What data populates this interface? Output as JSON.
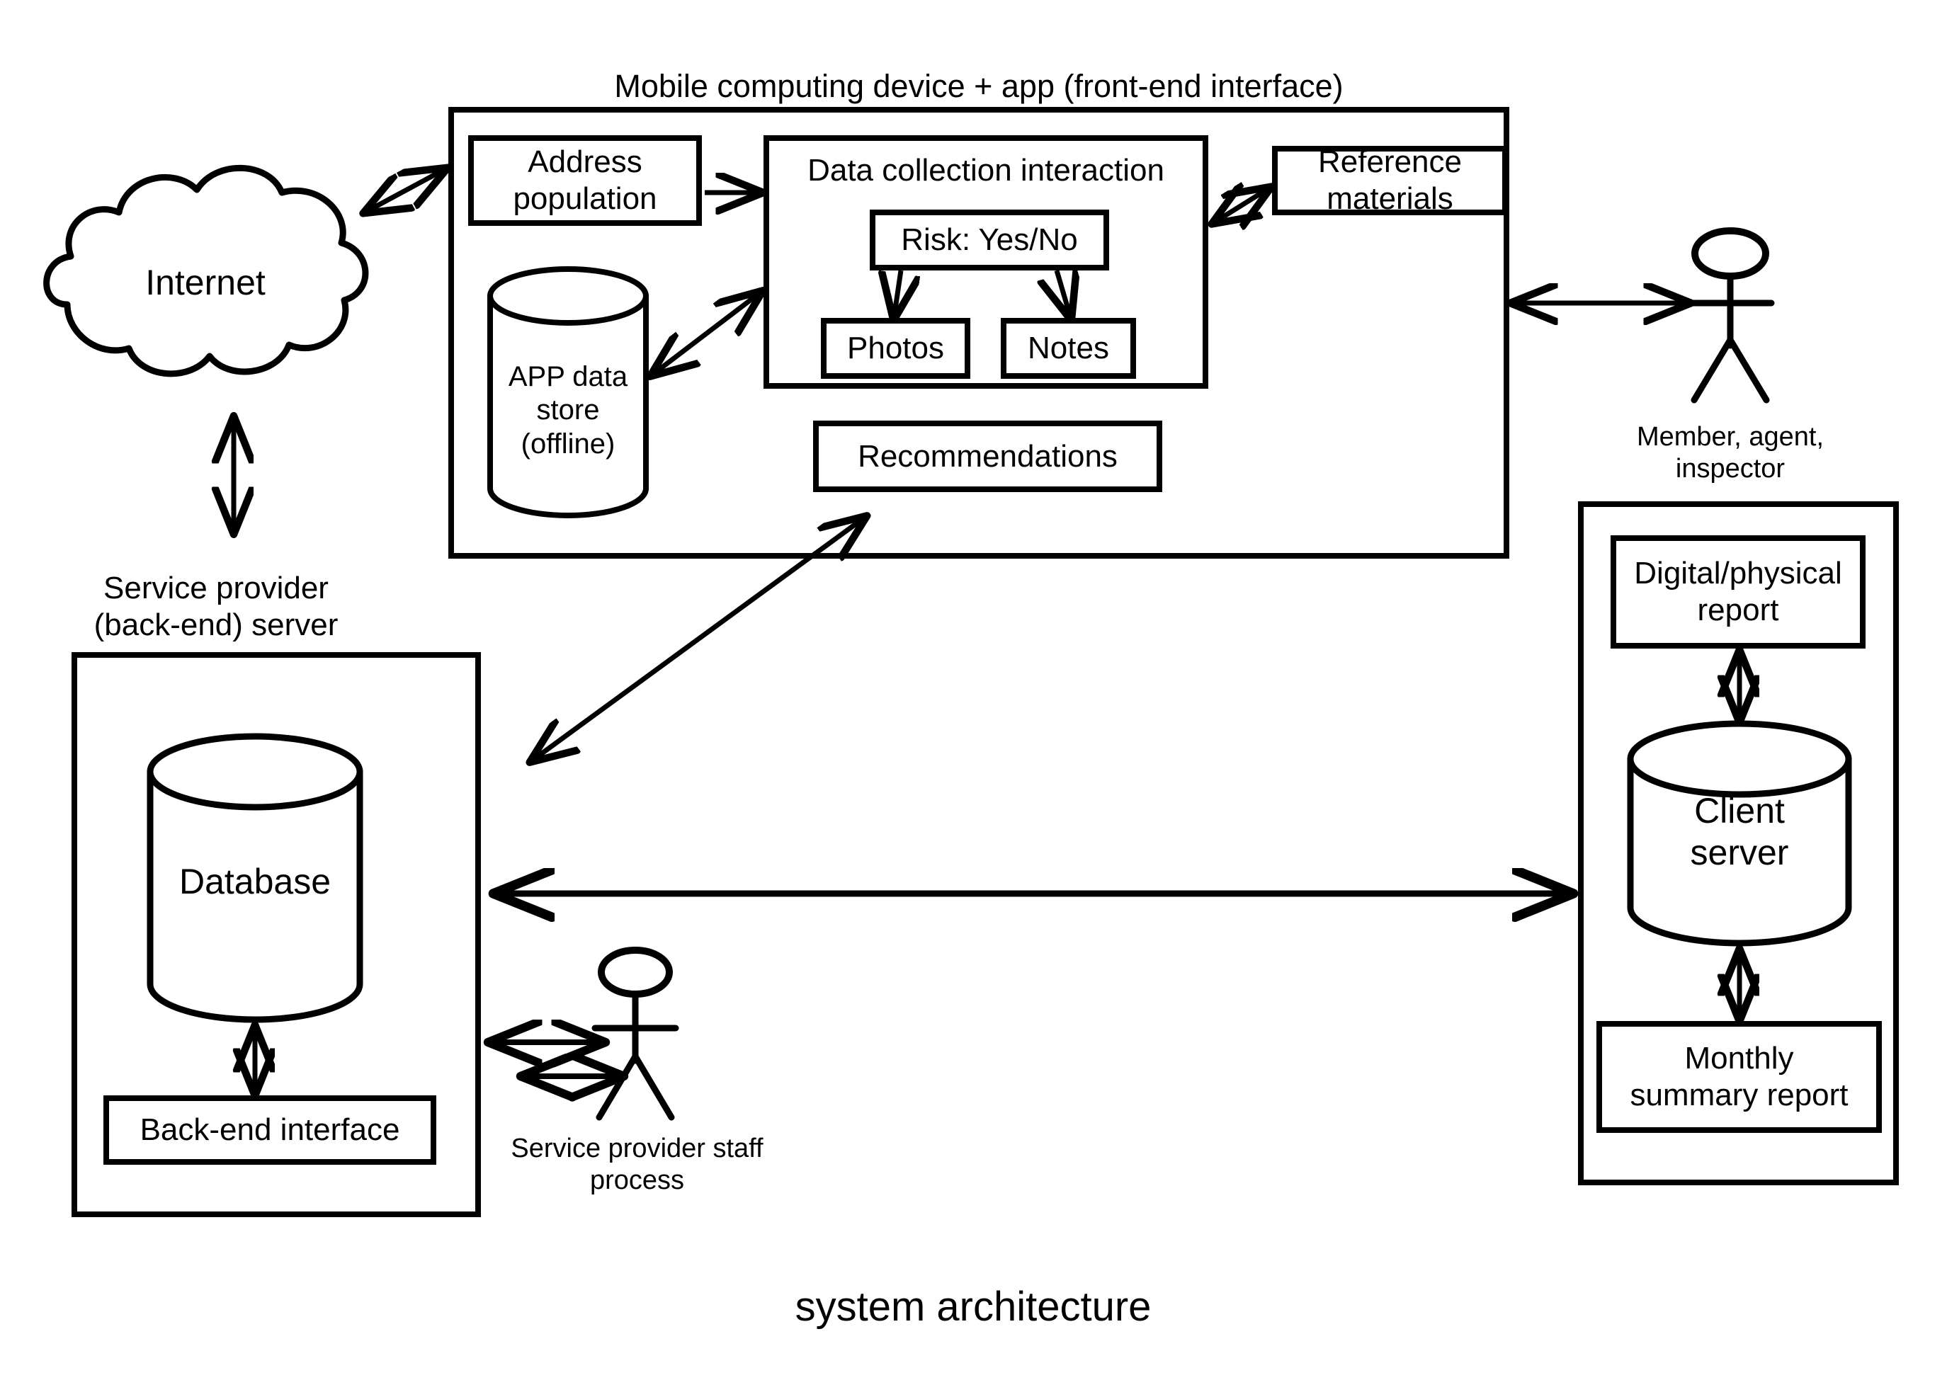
{
  "diagram": {
    "title": "system architecture",
    "panels": {
      "mobile": {
        "header": "Mobile computing device + app (front-end interface)",
        "boxes": {
          "address_population": "Address\npopulation",
          "data_collection": "Data collection interaction",
          "risk": "Risk: Yes/No",
          "photos": "Photos",
          "notes": "Notes",
          "reference_materials": "Reference\nmaterials",
          "app_data_store": "APP data\nstore\n(offline)",
          "recommendations": "Recommendations"
        }
      },
      "backend": {
        "header": "Service provider\n(back-end) server",
        "boxes": {
          "database": "Database",
          "backend_interface": "Back-end interface"
        }
      },
      "client": {
        "boxes": {
          "digital_physical_report": "Digital/physical\nreport",
          "client_server": "Client\nserver",
          "monthly_summary_report": "Monthly\nsummary report"
        }
      }
    },
    "nodes": {
      "internet": "Internet"
    },
    "actors": {
      "member_agent_inspector": "Member, agent,\ninspector",
      "service_provider_staff": "Service provider staff\nprocess"
    },
    "colors": {
      "stroke": "#000000",
      "background": "#ffffff"
    }
  }
}
